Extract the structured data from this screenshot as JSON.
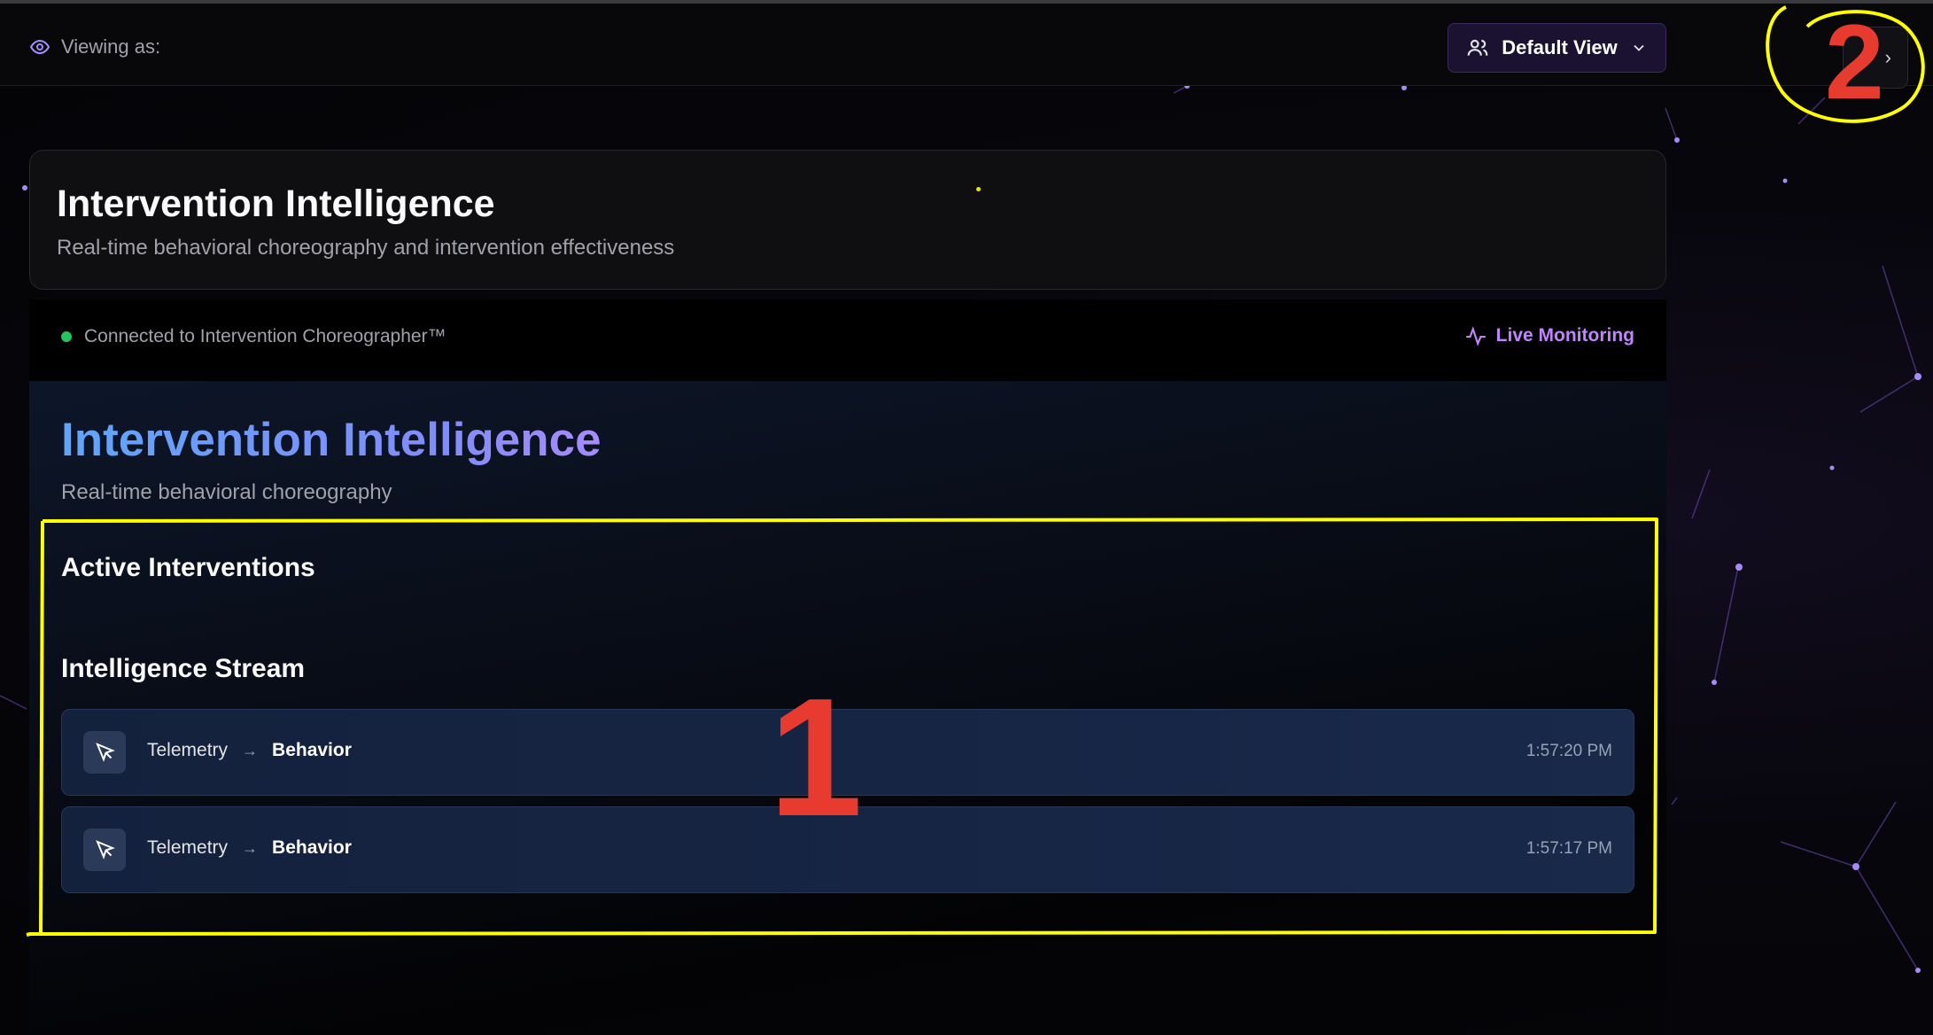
{
  "topbar": {
    "viewing_label": "Viewing as:",
    "view_button_label": "Default View",
    "corner_button_glyph": "›"
  },
  "header": {
    "title": "Intervention Intelligence",
    "subtitle": "Real-time behavioral choreography and intervention effectiveness"
  },
  "status": {
    "connection_text": "Connected to Intervention Choreographer™",
    "live_label": "Live Monitoring",
    "connection_color": "#22c55e",
    "live_color": "#c084fc"
  },
  "main": {
    "title": "Intervention Intelligence",
    "subtitle": "Real-time behavioral choreography",
    "active_heading": "Active Interventions",
    "stream_heading": "Intelligence Stream",
    "stream": [
      {
        "from": "Telemetry",
        "to": "Behavior",
        "time": "1:57:20 PM",
        "icon": "cursor-icon"
      },
      {
        "from": "Telemetry",
        "to": "Behavior",
        "time": "1:57:17 PM",
        "icon": "cursor-icon"
      }
    ]
  },
  "annotations": {
    "label_1": "1",
    "label_2": "2",
    "color": "#ffff00",
    "number_color": "#e63b2e"
  }
}
